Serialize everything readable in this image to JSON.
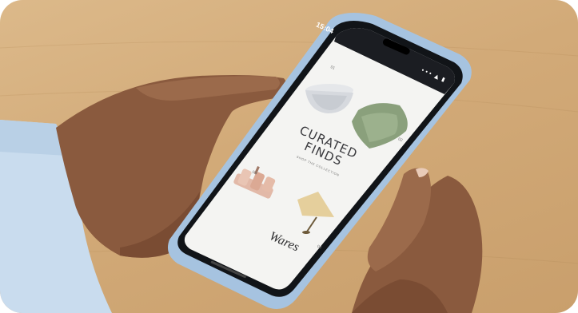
{
  "phone": {
    "status_time": "15:04",
    "status_icons": "••• ▲ ▮"
  },
  "app": {
    "headline_line1": "CURATED",
    "headline_line2": "FINDS",
    "subtitle": "SHOP THE COLLECTION",
    "brand": "Wares",
    "items": [
      {
        "number": "01",
        "icon": "bowl-icon"
      },
      {
        "number": "02",
        "icon": "pillow-icon"
      },
      {
        "number": "03",
        "icon": "bath-set-icon"
      },
      {
        "number": "04",
        "icon": "lamp-icon"
      }
    ]
  }
}
